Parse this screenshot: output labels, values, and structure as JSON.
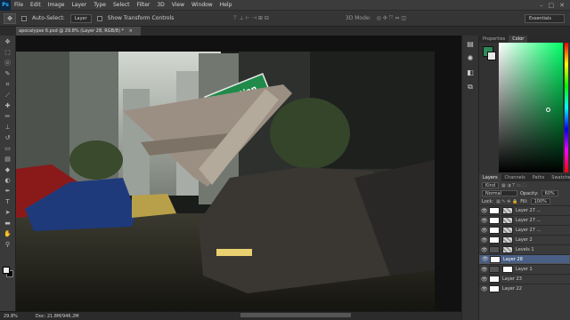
{
  "menubar": {
    "logo": "Ps",
    "items": [
      "File",
      "Edit",
      "Image",
      "Layer",
      "Type",
      "Select",
      "Filter",
      "3D",
      "View",
      "Window",
      "Help"
    ],
    "controls": [
      "–",
      "□",
      "✕"
    ]
  },
  "options_bar": {
    "auto_select_label": "Auto-Select:",
    "auto_select_value": "Layer",
    "show_transform_label": "Show Transform Controls",
    "mode_label": "3D Mode:",
    "workspace": "Essentials"
  },
  "document_tab": {
    "title": "apocalypse 6.psd @ 29.8% (Layer 28, RGB/8) *",
    "close": "×"
  },
  "statusbar": {
    "zoom": "29.8%",
    "doc": "Doc: 21.8M/946.2M"
  },
  "panels": {
    "color_tabs": [
      "Properties",
      "Color"
    ],
    "layer_tabs": [
      "Layers",
      "Channels",
      "Paths",
      "Swatches"
    ],
    "kind_label": "Kind",
    "blend_mode": "Normal",
    "opacity_label": "Opacity:",
    "opacity_value": "60%",
    "lock_label": "Lock:",
    "fill_label": "Fill:",
    "fill_value": "100%",
    "layers": [
      {
        "name": "Layer 27 ...",
        "selected": false
      },
      {
        "name": "Layer 27 ...",
        "selected": false
      },
      {
        "name": "Layer 27 ...",
        "selected": false
      },
      {
        "name": "Layer 2",
        "selected": false
      },
      {
        "name": "Levels 1",
        "selected": false
      },
      {
        "name": "Layer 28",
        "selected": true
      },
      {
        "name": "Layer 1",
        "selected": false
      },
      {
        "name": "Layer 23",
        "selected": false
      },
      {
        "name": "Layer 22",
        "selected": false
      }
    ]
  },
  "artwork": {
    "sign_text": "Christian"
  },
  "colors": {
    "accent": "#4a5f86",
    "foreground_swatch": "#2d8a5a"
  }
}
